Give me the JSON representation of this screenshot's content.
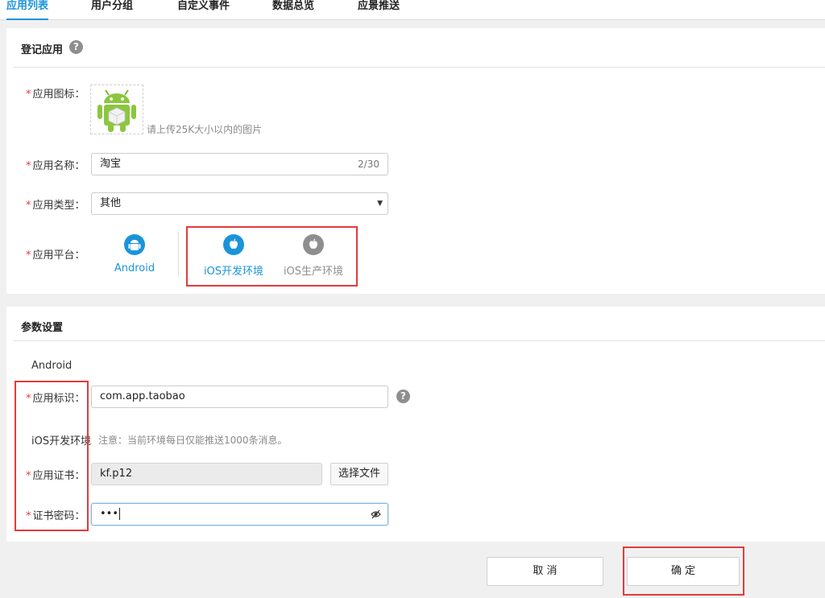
{
  "tabs": [
    {
      "label": "应用列表",
      "active": true
    },
    {
      "label": "用户分组",
      "active": false
    },
    {
      "label": "自定义事件",
      "active": false
    },
    {
      "label": "数据总览",
      "active": false
    },
    {
      "label": "应景推送",
      "active": false
    }
  ],
  "register": {
    "title": "登记应用",
    "help": "?",
    "icon_label": "应用图标：",
    "icon_hint": "请上传25K大小以内的图片",
    "name_label": "应用名称：",
    "name_value": "淘宝",
    "name_counter": "2/30",
    "type_label": "应用类型：",
    "type_value": "其他",
    "platform_label": "应用平台：",
    "platforms": [
      {
        "name": "Android",
        "icon": "android-icon",
        "color": "#1a94d9"
      },
      {
        "name": "iOS开发环境",
        "icon": "apple-icon",
        "color": "#1a94d9"
      },
      {
        "name": "iOS生产环境",
        "icon": "apple-icon",
        "color": "#8e8e8e"
      }
    ]
  },
  "params": {
    "title": "参数设置",
    "android_heading": "Android",
    "app_id_label": "应用标识：",
    "app_id_value": "com.app.taobao",
    "help": "?",
    "ios_heading": "iOS开发环境",
    "ios_note": "注意：当前环境每日仅能推送1000条消息。",
    "cert_label": "应用证书：",
    "cert_value": "kf.p12",
    "choose_file": "选择文件",
    "password_label": "证书密码：",
    "password_value": "•••",
    "required_mark": "*"
  },
  "actions": {
    "cancel": "取 消",
    "confirm": "确 定"
  },
  "colors": {
    "accent": "#1a94d9",
    "required": "#e8393a",
    "highlight_box": "#e23b3b"
  }
}
